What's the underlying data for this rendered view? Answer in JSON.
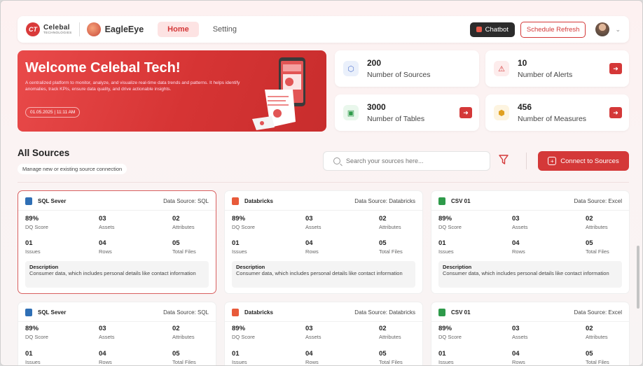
{
  "header": {
    "company_name": "Celebal",
    "company_sub": "TECHNOLOGIES",
    "product_name": "EagleEye",
    "nav": [
      {
        "label": "Home",
        "active": true
      },
      {
        "label": "Setting",
        "active": false
      }
    ],
    "chatbot_label": "Chatbot",
    "schedule_label": "Schedule Refresh"
  },
  "hero": {
    "title": "Welcome Celebal Tech!",
    "description": "A centralized platform to monitor, analyze, and visualize real-time data trends and patterns. It helps identify anomalies, track KPIs, ensure data quality, and drive actionable insights.",
    "date": "01.05.2025 | 11:11 AM"
  },
  "stats": [
    {
      "value": "200",
      "label": "Number of Sources",
      "icon": "cube-icon"
    },
    {
      "value": "10",
      "label": "Number of Alerts",
      "icon": "warning-icon"
    },
    {
      "value": "3000",
      "label": "Number of Tables",
      "icon": "table-icon"
    },
    {
      "value": "456",
      "label": "Number of Measures",
      "icon": "box-icon"
    }
  ],
  "sources": {
    "title": "All Sources",
    "subtitle": "Manage new or existing source connection",
    "search_placeholder": "Search your sources here...",
    "connect_label": "Connect to Sources"
  },
  "labels": {
    "dq": "DQ Score",
    "assets": "Assets",
    "attributes": "Attributes",
    "issues": "Issues",
    "rows": "Rows",
    "files": "Total Files",
    "description": "Description"
  },
  "cards": [
    {
      "name": "SQL Sever",
      "source": "Data Source: SQL",
      "dq": "89%",
      "assets": "03",
      "attributes": "02",
      "issues": "01",
      "rows": "04",
      "files": "05",
      "description": "Consumer data, which includes personal details like contact information"
    },
    {
      "name": "Databricks",
      "source": "Data Source: Databricks",
      "dq": "89%",
      "assets": "03",
      "attributes": "02",
      "issues": "01",
      "rows": "04",
      "files": "05",
      "description": "Consumer data, which includes personal details like contact information"
    },
    {
      "name": "CSV 01",
      "source": "Data Source: Excel",
      "dq": "89%",
      "assets": "03",
      "attributes": "02",
      "issues": "01",
      "rows": "04",
      "files": "05",
      "description": "Consumer data, which includes personal details like contact information"
    },
    {
      "name": "SQL Sever",
      "source": "Data Source: SQL",
      "dq": "89%",
      "assets": "03",
      "attributes": "02",
      "issues": "01",
      "rows": "04",
      "files": "05"
    },
    {
      "name": "Databricks",
      "source": "Data Source: Databricks",
      "dq": "89%",
      "assets": "03",
      "attributes": "02",
      "issues": "01",
      "rows": "04",
      "files": "05"
    },
    {
      "name": "CSV 01",
      "source": "Data Source: Excel",
      "dq": "89%",
      "assets": "03",
      "attributes": "02",
      "issues": "01",
      "rows": "04",
      "files": "05"
    }
  ],
  "colors": {
    "accent": "#d43838",
    "sql": "#2f6fb5",
    "databricks": "#e85a3a",
    "csv": "#2e9a4a"
  }
}
